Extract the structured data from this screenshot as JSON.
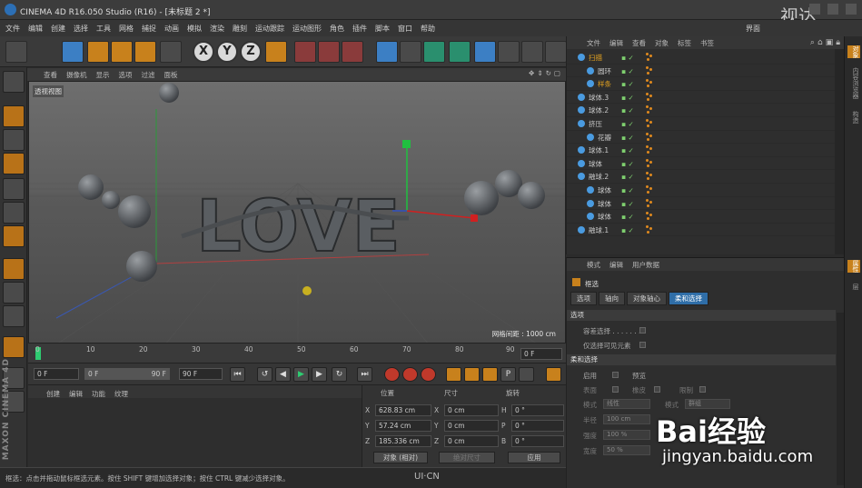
{
  "window": {
    "title": "CINEMA 4D R16.050 Studio (R16) - [未标题 2 *]",
    "watermark": "视达"
  },
  "menubar": [
    "文件",
    "编辑",
    "创建",
    "选择",
    "工具",
    "网格",
    "捕捉",
    "动画",
    "模拟",
    "渲染",
    "雕刻",
    "运动跟踪",
    "运动图形",
    "角色",
    "插件",
    "脚本",
    "窗口",
    "帮助"
  ],
  "menubar_right": "界面",
  "toolbar": {
    "axes": [
      "X",
      "Y",
      "Z"
    ]
  },
  "viewport": {
    "menu": [
      "查看",
      "摄像机",
      "显示",
      "选项",
      "过滤",
      "面板"
    ],
    "label": "透视视图",
    "model_text": "LOVE",
    "grid_distance": "网格间距 : 1000 cm",
    "nav_icons": [
      "move-icon",
      "zoom-icon",
      "rotate-icon",
      "maximize-icon"
    ]
  },
  "timeline": {
    "ticks": [
      "0",
      "10",
      "20",
      "30",
      "40",
      "50",
      "60",
      "70",
      "80",
      "90"
    ],
    "current_right": "0 F"
  },
  "transport": {
    "start": "0 F",
    "range_start": "0 F",
    "range_end": "90 F",
    "end": "90 F"
  },
  "materials": {
    "menu": [
      "创建",
      "编辑",
      "功能",
      "纹理"
    ]
  },
  "coordinates": {
    "headers": [
      "位置",
      "尺寸",
      "旋转"
    ],
    "rows": [
      {
        "axis": "X",
        "pos": "628.83 cm",
        "size_axis": "X",
        "size": "0 cm",
        "rot_axis": "H",
        "rot": "0 °"
      },
      {
        "axis": "Y",
        "pos": "57.24 cm",
        "size_axis": "Y",
        "size": "0 cm",
        "rot_axis": "P",
        "rot": "0 °"
      },
      {
        "axis": "Z",
        "pos": "185.336 cm",
        "size_axis": "Z",
        "size": "0 cm",
        "rot_axis": "B",
        "rot": "0 °"
      }
    ],
    "mode": "对象 (相对)",
    "size_mode": "绝对尺寸",
    "apply": "应用"
  },
  "status": "框选：点击并拖动鼠标框选元素。按住 SHIFT 键增加选择对象；按住 CTRL 键减少选择对象。",
  "status_logo": "UI·CN",
  "objects": {
    "menu": [
      "文件",
      "编辑",
      "查看",
      "对象",
      "标签",
      "书签"
    ],
    "items": [
      {
        "name": "扫描",
        "indent": 0,
        "color": "#e0a020"
      },
      {
        "name": "圆环",
        "indent": 1,
        "color": "#c8c8c8"
      },
      {
        "name": "样条",
        "indent": 1,
        "color": "#e0a020"
      },
      {
        "name": "球体.3",
        "indent": 0,
        "color": "#c8c8c8"
      },
      {
        "name": "球体.2",
        "indent": 0,
        "color": "#c8c8c8"
      },
      {
        "name": "挤压",
        "indent": 0,
        "color": "#c8c8c8"
      },
      {
        "name": "花瓣",
        "indent": 1,
        "color": "#c8c8c8"
      },
      {
        "name": "球体.1",
        "indent": 0,
        "color": "#c8c8c8"
      },
      {
        "name": "球体",
        "indent": 0,
        "color": "#c8c8c8"
      },
      {
        "name": "融球.2",
        "indent": 0,
        "color": "#c8c8c8"
      },
      {
        "name": "球体",
        "indent": 1,
        "color": "#c8c8c8"
      },
      {
        "name": "球体",
        "indent": 1,
        "color": "#c8c8c8"
      },
      {
        "name": "球体",
        "indent": 1,
        "color": "#c8c8c8"
      },
      {
        "name": "融球.1",
        "indent": 0,
        "color": "#c8c8c8"
      }
    ]
  },
  "attributes": {
    "menu": [
      "模式",
      "编辑",
      "用户数据"
    ],
    "title": "框选",
    "tabs": [
      "选项",
      "轴向",
      "对象轴心",
      "柔和选择"
    ],
    "active_tab": "柔和选择",
    "section_options": "选项",
    "opt1": "容差选择 . . . . . . .",
    "opt2": "仅选择可见元素",
    "section_soft": "柔和选择",
    "enable": "启用",
    "preview": "预览",
    "surface": "表面",
    "rubber": "橡皮",
    "restrict": "限制",
    "mode_label": "模式",
    "mode_value": "线性",
    "mode2_label": "模式",
    "mode2_value": "群组",
    "radius_label": "半径",
    "radius_value": "100 cm",
    "strength_label": "强度",
    "strength_value": "100 %",
    "width_label": "宽度",
    "width_value": "50 %"
  },
  "right_tabs": [
    "对象",
    "内容浏览器",
    "构造",
    "属性",
    "层"
  ],
  "watermark_bottom": {
    "brand": "Bai经验",
    "url": "jingyan.baidu.com"
  }
}
